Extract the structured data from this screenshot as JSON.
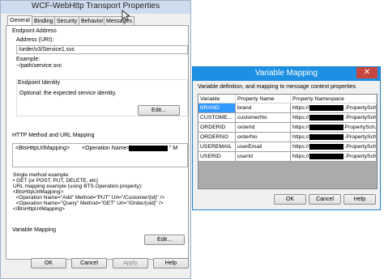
{
  "wcf": {
    "title": "WCF-WebHttp Transport Properties",
    "tabs": [
      "General",
      "Binding",
      "Security",
      "Behavior",
      "Messages"
    ],
    "endpoint_address_group": "Endpoint Address",
    "address_label": "Address (URI):",
    "address_value": "/order/v3/Service1.svc",
    "example_label": "Example:",
    "example_value": "~/path/service.svc",
    "endpoint_identity_group": "Endpoint Identity",
    "identity_text": "Optional: the expected service identity.",
    "edit_button": "Edit...",
    "http_group": "HTTP Method and URL Mapping",
    "mapping_line_1": "<BtsHttpUrlMapping>",
    "mapping_line_2": "<Operation Name=\"Get",
    "mapping_line_2b": "\" M",
    "help_text": "Single method example:\n• GET (or POST, PUT, DELETE, etc)\nURL mapping example (using BTS.Operation property):\n<BtsHttpUrlMapping>\n  <Operation Name=\"Add\" Method=\"PUT\" Url=\"/Customer/{id}\" />\n  <Operation Name=\"Query\" Method=\"GET\" Url=\"/Order/{oid}\" />\n</BtsHttpUrlMapping>",
    "variable_mapping_group": "Variable Mapping",
    "edit_button_2": "Edit...",
    "ok_button": "OK",
    "cancel_button": "Cancel",
    "apply_button": "Apply",
    "help_button": "Help"
  },
  "vm": {
    "title": "Variable Mapping",
    "close_symbol": "✕",
    "description": "Variable definition, and mapping to message context properties",
    "columns": [
      "Variable",
      "Property Name",
      "Property Namespace"
    ],
    "rows": [
      {
        "variable": "BRAND",
        "property": "brand",
        "ns_prefix": "https://",
        "ns_suffix": ".PropertySch..."
      },
      {
        "variable": "CUSTOME...",
        "property": "customerNo",
        "ns_prefix": "https://",
        "ns_suffix": ".PropertySch..."
      },
      {
        "variable": "ORDERID",
        "property": "orderId",
        "ns_prefix": "https://",
        "ns_suffix": "PropertySch..."
      },
      {
        "variable": "ORDERNO",
        "property": "orderNo",
        "ns_prefix": "https://",
        "ns_suffix": ".PropertySch..."
      },
      {
        "variable": "USEREMAIL",
        "property": "userEmail",
        "ns_prefix": "https://",
        "ns_suffix": ".PropertySch..."
      },
      {
        "variable": "USERID",
        "property": "userId",
        "ns_prefix": "https://",
        "ns_suffix": ".PropertySch..."
      }
    ],
    "ok_button": "OK",
    "cancel_button": "Cancel",
    "help_button": "Help"
  },
  "colors": {
    "vm_title_bar": "#1e90e4",
    "selected_cell": "#3399ff",
    "close_button": "#c7463f"
  }
}
